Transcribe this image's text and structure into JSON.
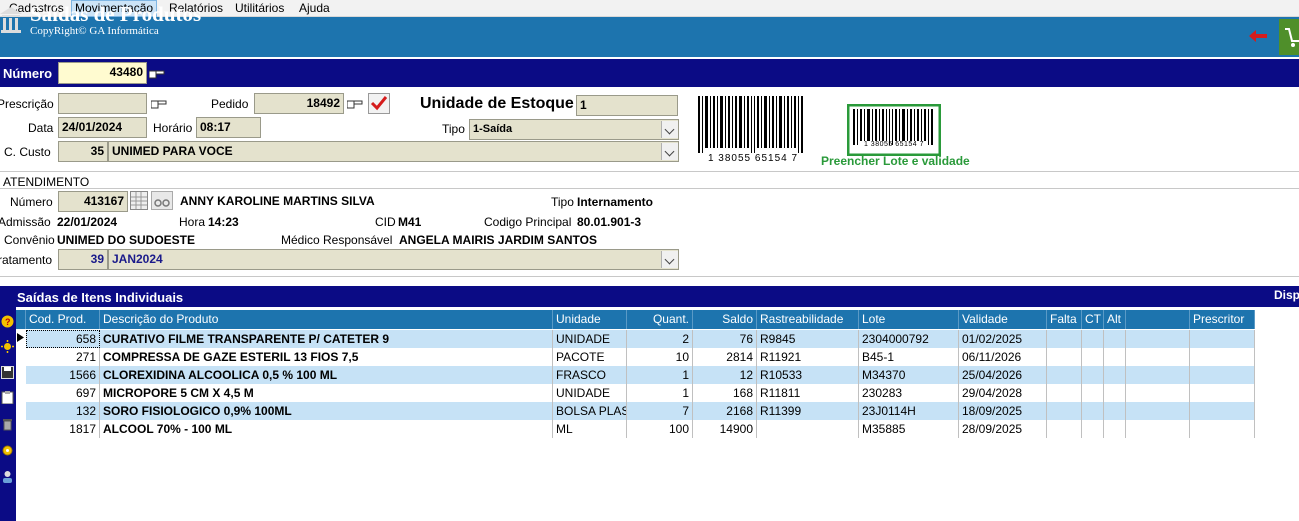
{
  "menu": [
    "Cadastros",
    "Movimentação",
    "Relatórios",
    "Utilitários",
    "Ajuda"
  ],
  "header": {
    "title": "Saídas de Produtos",
    "subtitle": "CopyRight© GA Informática"
  },
  "numero": {
    "label": "Número",
    "value": "43480"
  },
  "form": {
    "prescricao_label": "Prescrição",
    "prescricao_value": "",
    "pedido_label": "Pedido",
    "pedido_value": "18492",
    "unidade_label": "Unidade de Estoque",
    "unidade_value": "1",
    "data_label": "Data",
    "data_value": "24/01/2024",
    "horario_label": "Horário",
    "horario_value": "08:17",
    "tipo_label": "Tipo",
    "tipo_value": "1-Saída",
    "custo_label": "C. Custo",
    "custo_code": "35",
    "custo_value": "UNIMED PARA VOCE",
    "barcode_digits": "1  38055 65154  7",
    "barcode_small_digits": "1  38055 65154  7",
    "preencher_label": "Preencher Lote e validade"
  },
  "atendimento": {
    "title": "ATENDIMENTO",
    "numero_label": "Número",
    "numero_value": "413167",
    "patient_name": "ANNY KAROLINE MARTINS SILVA",
    "tipo_label": "Tipo",
    "tipo_value": "Internamento",
    "admissao_label": "Admissão",
    "admissao_value": "22/01/2024",
    "hora_label": "Hora",
    "hora_value": "14:23",
    "cid_label": "CID",
    "cid_value": "M41",
    "codigo_label": "Codigo Principal",
    "codigo_value": "80.01.901-3",
    "convenio_label": "Convênio",
    "convenio_value": "UNIMED DO SUDOESTE",
    "medico_label": "Médico Responsável",
    "medico_value": "ANGELA MAIRIS JARDIM SANTOS",
    "tratamento_label": "ratamento",
    "tratamento_code": "39",
    "tratamento_value": "JAN2024"
  },
  "grid": {
    "title": "Saídas de Itens Individuais",
    "right_label": "Disp",
    "columns": [
      "Cod. Prod.",
      "Descrição do Produto",
      "Unidade",
      "Quant.",
      "Saldo",
      "Rastreabilidade",
      "Lote",
      "Validade",
      "Falta",
      "CT",
      "Alt",
      "",
      "Prescritor"
    ],
    "rows": [
      [
        "658",
        "CURATIVO FILME TRANSPARENTE P/ CATETER 9",
        "UNIDADE",
        "2",
        "76",
        "R9845",
        "2304000792",
        "01/02/2025"
      ],
      [
        "271",
        "COMPRESSA DE GAZE ESTERIL 13 FIOS 7,5",
        "PACOTE",
        "10",
        "2814",
        "R11921",
        "B45-1",
        "06/11/2026"
      ],
      [
        "1566",
        "CLOREXIDINA ALCOOLICA 0,5 % 100 ML",
        "FRASCO",
        "1",
        "12",
        "R10533",
        "M34370",
        "25/04/2026"
      ],
      [
        "697",
        "MICROPORE  5 CM X 4,5 M",
        "UNIDADE",
        "1",
        "168",
        "R11811",
        "230283",
        "29/04/2028"
      ],
      [
        "132",
        "SORO FISIOLOGICO 0,9% 100ML",
        "BOLSA PLAS",
        "7",
        "2168",
        "R11399",
        "23J0114H",
        "18/09/2025"
      ],
      [
        "1817",
        "ALCOOL 70% - 100 ML",
        "ML",
        "100",
        "14900",
        "",
        "M35885",
        "28/09/2025"
      ]
    ]
  },
  "colors": {
    "header_blue": "#1d74ae",
    "navy": "#0b0b85",
    "row_highlight": "#c6e2f6",
    "field_bg": "#e4e2cd",
    "green": "#2a9a3a"
  }
}
